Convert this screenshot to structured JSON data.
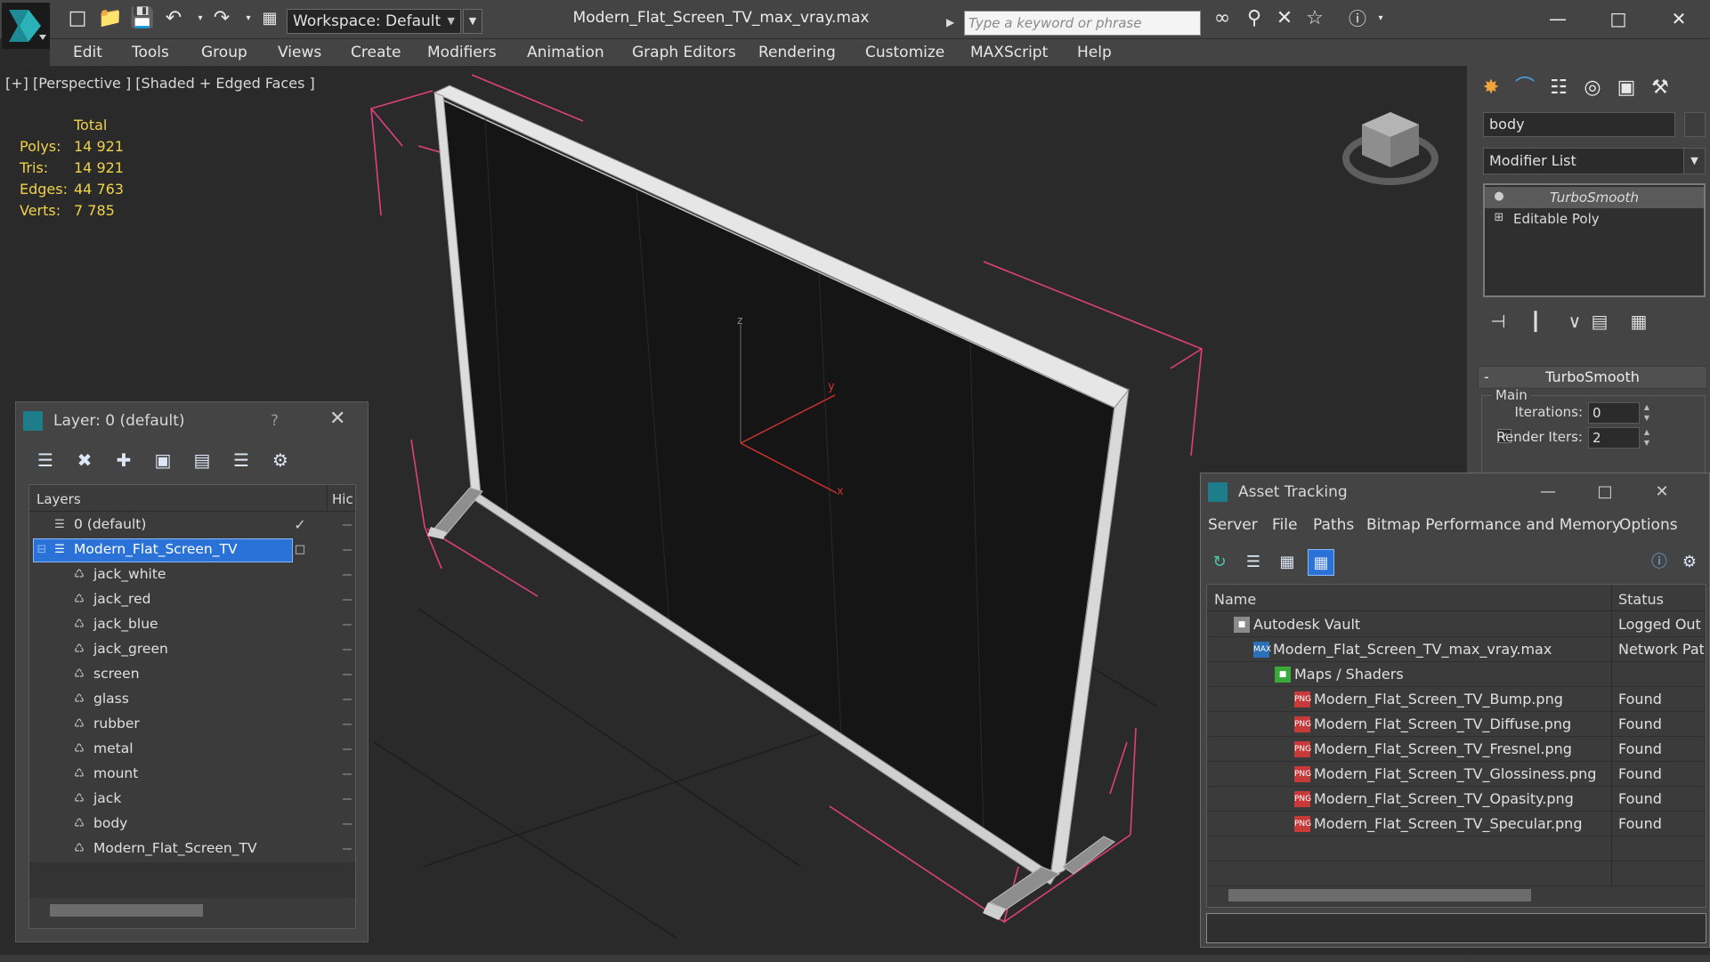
{
  "app": {
    "file_title": "Modern_Flat_Screen_TV_max_vray.max",
    "workspace": "Workspace: Default",
    "search_placeholder": "Type a keyword or phrase"
  },
  "menu": [
    "Edit",
    "Tools",
    "Group",
    "Views",
    "Create",
    "Modifiers",
    "Animation",
    "Graph Editors",
    "Rendering",
    "Customize",
    "MAXScript",
    "Help"
  ],
  "viewport": {
    "label": "[+] [Perspective ] [Shaded + Edged Faces ]",
    "stats": {
      "header": "Total",
      "rows": [
        {
          "k": "Polys:",
          "v": "14 921"
        },
        {
          "k": "Tris:",
          "v": "14 921"
        },
        {
          "k": "Edges:",
          "v": "44 763"
        },
        {
          "k": "Verts:",
          "v": "7 785"
        }
      ]
    },
    "axis": {
      "x": "x",
      "y": "y",
      "z": "z"
    }
  },
  "command_panel": {
    "object_name": "body",
    "modifier_list": "Modifier List",
    "stack": [
      "TurboSmooth",
      "Editable Poly"
    ],
    "rollout_title": "TurboSmooth",
    "group_label": "Main",
    "iterations_label": "Iterations:",
    "iterations_value": "0",
    "render_iters_label": "Render Iters:",
    "render_iters_value": "2"
  },
  "layer_window": {
    "title": "Layer: 0 (default)",
    "help": "?",
    "col_layers": "Layers",
    "col_hide": "Hic",
    "rows": [
      {
        "label": "0 (default)",
        "level": 0,
        "type": "layer"
      },
      {
        "label": "Modern_Flat_Screen_TV",
        "level": 0,
        "type": "layer",
        "selected": true
      },
      {
        "label": "jack_white",
        "level": 1,
        "type": "object"
      },
      {
        "label": "jack_red",
        "level": 1,
        "type": "object"
      },
      {
        "label": "jack_blue",
        "level": 1,
        "type": "object"
      },
      {
        "label": "jack_green",
        "level": 1,
        "type": "object"
      },
      {
        "label": "screen",
        "level": 1,
        "type": "object"
      },
      {
        "label": "glass",
        "level": 1,
        "type": "object"
      },
      {
        "label": "rubber",
        "level": 1,
        "type": "object"
      },
      {
        "label": "metal",
        "level": 1,
        "type": "object"
      },
      {
        "label": "mount",
        "level": 1,
        "type": "object"
      },
      {
        "label": "jack",
        "level": 1,
        "type": "object"
      },
      {
        "label": "body",
        "level": 1,
        "type": "object"
      },
      {
        "label": "Modern_Flat_Screen_TV",
        "level": 1,
        "type": "object"
      }
    ]
  },
  "asset_window": {
    "title": "Asset Tracking",
    "menu": [
      "Server",
      "File",
      "Paths",
      "Bitmap Performance and Memory",
      "Options"
    ],
    "col_name": "Name",
    "col_status": "Status",
    "rows": [
      {
        "name": "Autodesk Vault",
        "status": "Logged Out",
        "level": 0,
        "icon": "vault"
      },
      {
        "name": "Modern_Flat_Screen_TV_max_vray.max",
        "status": "Network Path",
        "level": 1,
        "icon": "max"
      },
      {
        "name": "Maps / Shaders",
        "status": "",
        "level": 2,
        "icon": "maps"
      },
      {
        "name": "Modern_Flat_Screen_TV_Bump.png",
        "status": "Found",
        "level": 3,
        "icon": "png"
      },
      {
        "name": "Modern_Flat_Screen_TV_Diffuse.png",
        "status": "Found",
        "level": 3,
        "icon": "png"
      },
      {
        "name": "Modern_Flat_Screen_TV_Fresnel.png",
        "status": "Found",
        "level": 3,
        "icon": "png"
      },
      {
        "name": "Modern_Flat_Screen_TV_Glossiness.png",
        "status": "Found",
        "level": 3,
        "icon": "png"
      },
      {
        "name": "Modern_Flat_Screen_TV_Opasity.png",
        "status": "Found",
        "level": 3,
        "icon": "png"
      },
      {
        "name": "Modern_Flat_Screen_TV_Specular.png",
        "status": "Found",
        "level": 3,
        "icon": "png"
      }
    ]
  },
  "colors": {
    "stats": "#f0d24a",
    "selection": "#2a72d8",
    "bbox": "#e0407a",
    "axis": "#d03030"
  }
}
